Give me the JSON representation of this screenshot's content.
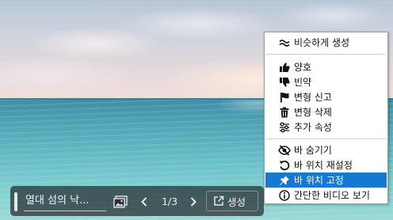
{
  "bar": {
    "title": "열대 섬의 낙...",
    "page_indicator": "1/3",
    "generate_label": "생성"
  },
  "menu": {
    "items": [
      {
        "label": "비슷하게 생성",
        "icon": "approx-icon"
      },
      {
        "label": "양호",
        "icon": "thumbs-up-icon"
      },
      {
        "label": "빈약",
        "icon": "thumbs-down-icon"
      },
      {
        "label": "변형 신고",
        "icon": "flag-icon"
      },
      {
        "label": "변형 삭제",
        "icon": "trash-icon"
      },
      {
        "label": "추가 속성",
        "icon": "sliders-icon"
      },
      {
        "label": "바 숨기기",
        "icon": "eye-slash-icon"
      },
      {
        "label": "바 위치 재설정",
        "icon": "reset-icon"
      },
      {
        "label": "바 위치 고정",
        "icon": "pin-icon"
      },
      {
        "label": "간단한 비디오 보기",
        "icon": "info-icon"
      }
    ],
    "selected_label": "바 위치 고정"
  },
  "colors": {
    "menu_highlight": "#1478d4",
    "bar_background": "#262a2e"
  }
}
